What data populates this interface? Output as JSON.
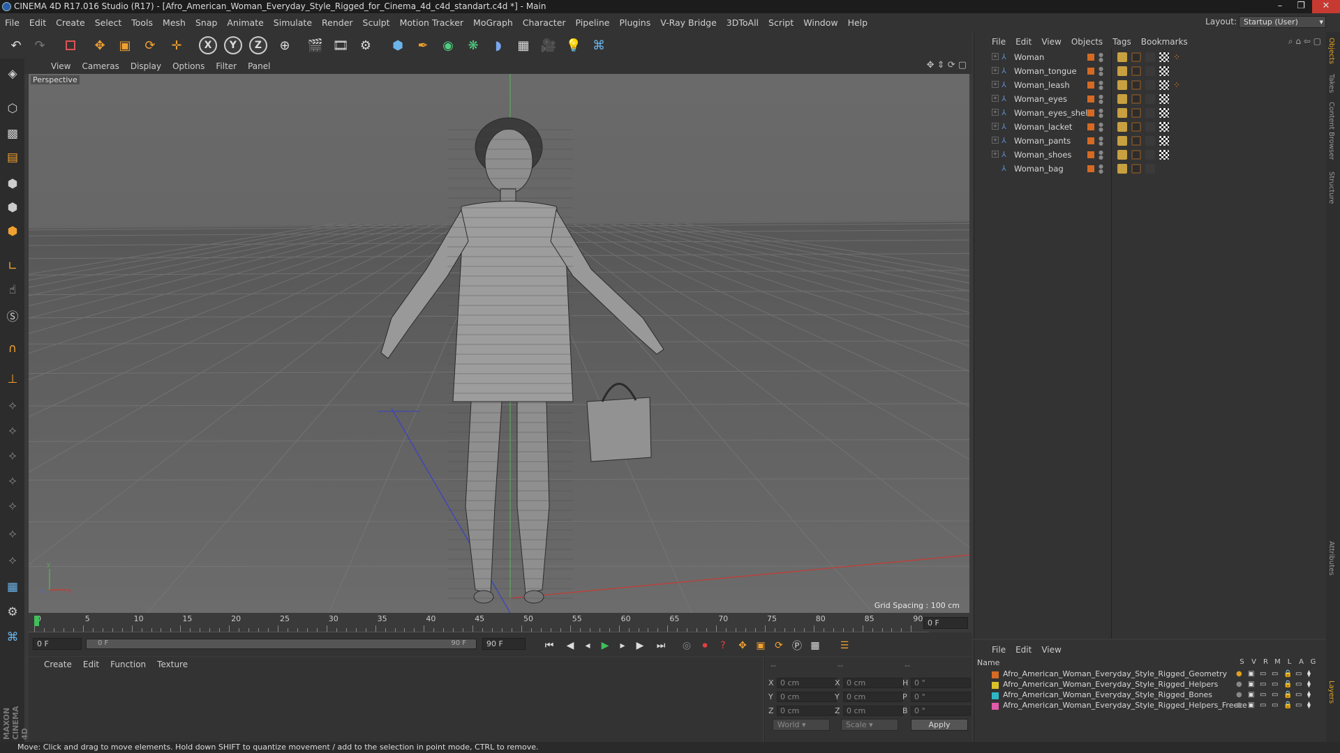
{
  "window": {
    "title": "CINEMA 4D R17.016 Studio (R17) - [Afro_American_Woman_Everyday_Style_Rigged_for_Cinema_4d_c4d_standart.c4d *] - Main"
  },
  "menubar": {
    "items": [
      "File",
      "Edit",
      "Create",
      "Select",
      "Tools",
      "Mesh",
      "Snap",
      "Animate",
      "Simulate",
      "Render",
      "Sculpt",
      "Motion Tracker",
      "MoGraph",
      "Character",
      "Pipeline",
      "Plugins",
      "V-Ray Bridge",
      "3DToAll",
      "Script",
      "Window",
      "Help"
    ],
    "layout_label": "Layout:",
    "layout_value": "Startup (User)"
  },
  "toolbar": {
    "axis_x": "X",
    "axis_y": "Y",
    "axis_z": "Z"
  },
  "viewport": {
    "menu": [
      "View",
      "Cameras",
      "Display",
      "Options",
      "Filter",
      "Panel"
    ],
    "camera_label": "Perspective",
    "grid_spacing": "Grid Spacing : 100 cm"
  },
  "timeline": {
    "ticks": [
      "0",
      "5",
      "10",
      "15",
      "20",
      "25",
      "30",
      "35",
      "40",
      "45",
      "50",
      "55",
      "60",
      "65",
      "70",
      "75",
      "80",
      "85",
      "90"
    ],
    "current_frame": "0 F",
    "start_field": "0 F",
    "range_start": "0 F",
    "range_end": "90 F",
    "end_field": "90 F"
  },
  "material_panel": {
    "menu": [
      "Create",
      "Edit",
      "Function",
      "Texture"
    ]
  },
  "coords": {
    "header": [
      "--",
      "--",
      "--"
    ],
    "pos_labels": [
      "X",
      "Y",
      "Z"
    ],
    "pos_values": [
      "0 cm",
      "0 cm",
      "0 cm"
    ],
    "size_labels": [
      "X",
      "Y",
      "Z"
    ],
    "size_values": [
      "0 cm",
      "0 cm",
      "0 cm"
    ],
    "rot_labels": [
      "H",
      "P",
      "B"
    ],
    "rot_values": [
      "0 °",
      "0 °",
      "0 °"
    ],
    "space": "World",
    "mode": "Scale",
    "apply": "Apply"
  },
  "object_manager": {
    "menu": [
      "File",
      "Edit",
      "View",
      "Objects",
      "Tags",
      "Bookmarks"
    ],
    "objects": [
      {
        "name": "Woman"
      },
      {
        "name": "Woman_tongue"
      },
      {
        "name": "Woman_leash"
      },
      {
        "name": "Woman_eyes"
      },
      {
        "name": "Woman_eyes_shell"
      },
      {
        "name": "Woman_lacket"
      },
      {
        "name": "Woman_pants"
      },
      {
        "name": "Woman_shoes"
      },
      {
        "name": "Woman_bag"
      }
    ]
  },
  "layer_manager": {
    "menu": [
      "File",
      "Edit",
      "View"
    ],
    "column_name": "Name",
    "columns": [
      "S",
      "V",
      "R",
      "M",
      "L",
      "A",
      "G"
    ],
    "layers": [
      {
        "name": "Afro_American_Woman_Everyday_Style_Rigged_Geometry",
        "color": "#d46a23"
      },
      {
        "name": "Afro_American_Woman_Everyday_Style_Rigged_Helpers",
        "color": "#d8c228"
      },
      {
        "name": "Afro_American_Woman_Everyday_Style_Rigged_Bones",
        "color": "#2fb7c7"
      },
      {
        "name": "Afro_American_Woman_Everyday_Style_Rigged_Helpers_Freeze",
        "color": "#e05aa8"
      }
    ]
  },
  "right_tabs": [
    "Objects",
    "Takes",
    "Content Browser",
    "Structure",
    "Attributes",
    "Layers"
  ],
  "brand": "MAXON CINEMA 4D",
  "status": "Move: Click and drag to move elements. Hold down SHIFT to quantize movement / add to the selection in point mode, CTRL to remove."
}
